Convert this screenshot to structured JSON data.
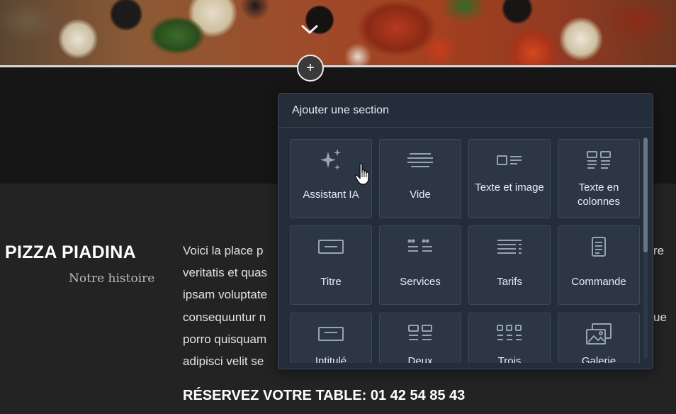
{
  "hero": {
    "chevron_icon": "chevron-down-icon"
  },
  "add_section_button": {
    "icon": "plus-icon",
    "symbol": "+"
  },
  "page": {
    "title": "PIZZA PIADINA",
    "subtitle": "Notre histoire",
    "body_lines": [
      {
        "left": "Voici la place p",
        "right": "re"
      },
      {
        "left": "veritatis et quas",
        "right": ""
      },
      {
        "left": "ipsam voluptate",
        "right": ""
      },
      {
        "left": "consequuntur n",
        "right": "ue"
      },
      {
        "left": "porro quisquam",
        "right": ""
      },
      {
        "left": "adipisci velit se",
        "right": ""
      }
    ],
    "reserve": "RÉSERVEZ VOTRE TABLE: 01 42 54 85 43"
  },
  "popup": {
    "title": "Ajouter une section",
    "tiles": [
      {
        "label": "Assistant IA",
        "icon": "sparkles-icon"
      },
      {
        "label": "Vide",
        "icon": "blank-lines-icon"
      },
      {
        "label": "Texte et image",
        "icon": "text-image-icon"
      },
      {
        "label": "Texte en colonnes",
        "icon": "text-columns-icon"
      },
      {
        "label": "Titre",
        "icon": "title-icon"
      },
      {
        "label": "Services",
        "icon": "services-icon"
      },
      {
        "label": "Tarifs",
        "icon": "pricing-icon"
      },
      {
        "label": "Commande",
        "icon": "order-icon"
      },
      {
        "label": "Intitulé",
        "icon": "heading-icon"
      },
      {
        "label": "Deux",
        "icon": "two-columns-icon"
      },
      {
        "label": "Trois",
        "icon": "three-columns-icon"
      },
      {
        "label": "Galerie",
        "icon": "gallery-icon"
      }
    ]
  },
  "cursor": {
    "icon": "hand-pointer-icon"
  }
}
